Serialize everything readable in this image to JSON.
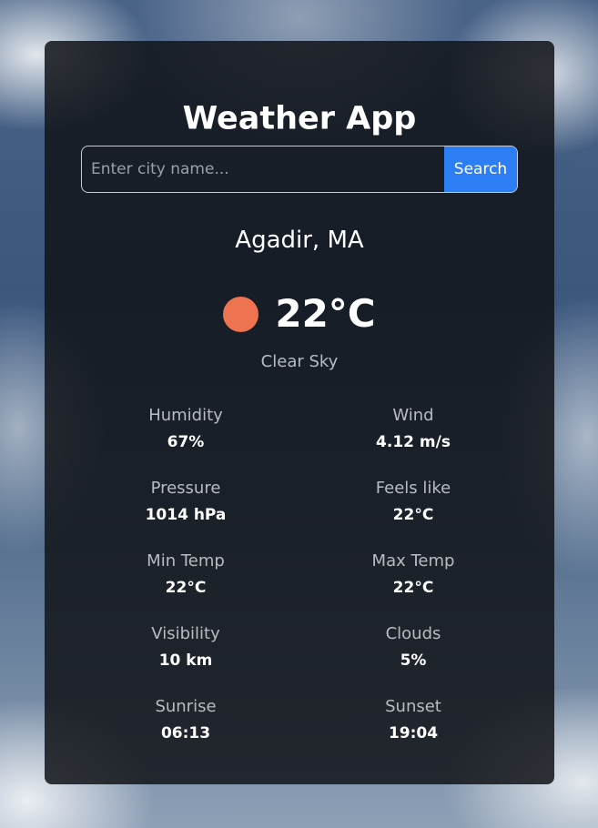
{
  "app": {
    "title": "Weather App"
  },
  "search": {
    "placeholder": "Enter city name...",
    "value": "",
    "button_label": "Search"
  },
  "current": {
    "city": "Agadir, MA",
    "temperature": "22°C",
    "condition": "Clear Sky",
    "icon": "sun-icon",
    "icon_color": "#ee7350"
  },
  "details": {
    "humidity": {
      "label": "Humidity",
      "value": "67%"
    },
    "wind": {
      "label": "Wind",
      "value": "4.12 m/s"
    },
    "pressure": {
      "label": "Pressure",
      "value": "1014 hPa"
    },
    "feels_like": {
      "label": "Feels like",
      "value": "22°C"
    },
    "min_temp": {
      "label": "Min Temp",
      "value": "22°C"
    },
    "max_temp": {
      "label": "Max Temp",
      "value": "22°C"
    },
    "visibility": {
      "label": "Visibility",
      "value": "10 km"
    },
    "clouds": {
      "label": "Clouds",
      "value": "5%"
    },
    "sunrise": {
      "label": "Sunrise",
      "value": "06:13"
    },
    "sunset": {
      "label": "Sunset",
      "value": "19:04"
    }
  },
  "colors": {
    "accent": "#2d7ef4",
    "card_background": "#121418"
  }
}
